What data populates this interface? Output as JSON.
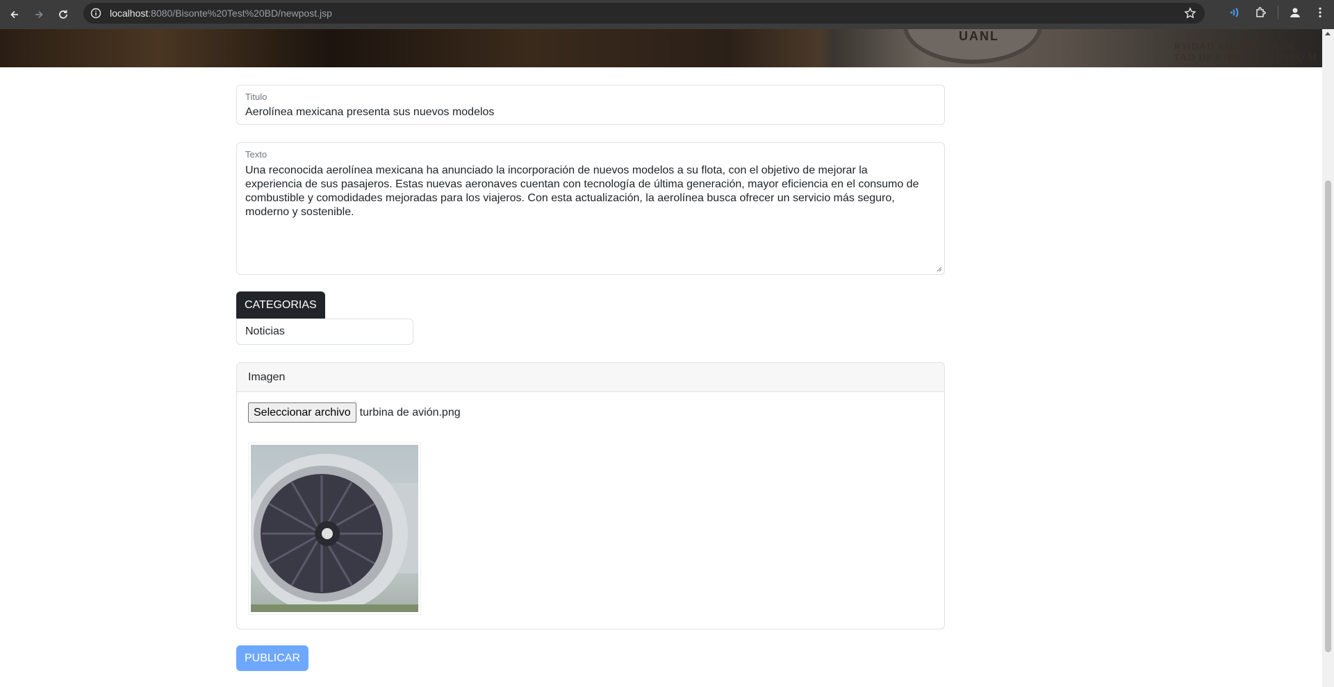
{
  "browser": {
    "url_host": "localhost",
    "url_rest": ":8080/Bisonte%20Test%20BD/newpost.jsp"
  },
  "banner": {
    "seal_text": "UANL",
    "engraving_line1": "RSIDAD AUTÓNOMA DE",
    "engraving_line2": "TAD DE CIENCIAS FÍSICO M"
  },
  "form": {
    "title_label": "Titulo",
    "title_value": "Aerolínea mexicana presenta sus nuevos modelos",
    "text_label": "Texto",
    "text_value": "Una reconocida aerolínea mexicana ha anunciado la incorporación de nuevos modelos a su flota, con el objetivo de mejorar la experiencia de sus pasajeros. Estas nuevas aeronaves cuentan con tecnología de última generación, mayor eficiencia en el consumo de combustible y comodidades mejoradas para los viajeros. Con esta actualización, la aerolínea busca ofrecer un servicio más seguro, moderno y sostenible.",
    "categories_label": "CATEGORIAS",
    "category_selected": "Noticias",
    "image_header": "Imagen",
    "file_button": "Seleccionar archivo",
    "file_name": "turbina de avión.png",
    "publish_label": "PUBLICAR"
  },
  "colors": {
    "publish_bg": "#6ea8fe",
    "categories_bg": "#212529"
  },
  "icons": [
    "back-icon",
    "forward-icon",
    "reload-icon",
    "site-info-icon",
    "bookmark-star-icon",
    "media-icon",
    "extensions-icon",
    "profile-icon",
    "menu-icon",
    "jet-engine-image"
  ]
}
